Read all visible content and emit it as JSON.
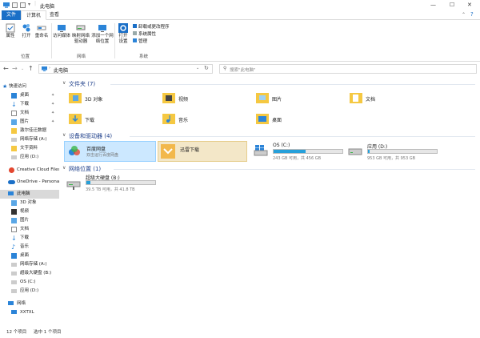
{
  "window": {
    "title": "此电脑"
  },
  "ribbon_tabs": [
    {
      "label": "文件"
    },
    {
      "label": "计算机"
    },
    {
      "label": "查看"
    }
  ],
  "ribbon": {
    "location_buttons": [
      "属性",
      "打开",
      "重命名"
    ],
    "network_buttons": [
      "访问媒体",
      "映射网络驱动器",
      "添加一个网络位置"
    ],
    "open_settings": "打开设置",
    "system_items": [
      "卸载或更改程序",
      "系统属性",
      "管理"
    ],
    "groups": {
      "location": "位置",
      "network": "网络",
      "system": "系统"
    }
  },
  "address": {
    "path": "此电脑",
    "search_placeholder": "搜索\"此电脑\""
  },
  "sidebar": {
    "quick_access": "快速访问",
    "quick_items": [
      "桌面",
      "下载",
      "文档",
      "图片",
      "激尔佳迁数据",
      "网络存储 (A:)",
      "文字资料",
      "应用 (D:)"
    ],
    "creative_cloud": "Creative Cloud Files",
    "onedrive": "OneDrive - Personal",
    "this_pc": "此电脑",
    "pc_items": [
      "3D 对象",
      "视频",
      "图片",
      "文档",
      "下载",
      "音乐",
      "桌面",
      "网络存储 (A:)",
      "超级大硬盘 (B:)",
      "OS (C:)",
      "应用 (D:)"
    ],
    "network": "网络",
    "network_items": [
      "XXTXL"
    ]
  },
  "main": {
    "folders_header": "文件夹 (7)",
    "folders": [
      "3D 对象",
      "视频",
      "图片",
      "文档",
      "下载",
      "音乐",
      "桌面"
    ],
    "devices_header": "设备和驱动器 (4)",
    "apps": [
      {
        "name": "百度网盘",
        "sub": "双击运行百度网盘"
      },
      {
        "name": "迅雷下载",
        "sub": ""
      }
    ],
    "drives": [
      {
        "name": "OS (C:)",
        "free": "243 GB 可用，共 456 GB",
        "used_fraction": 0.47
      },
      {
        "name": "应用 (D:)",
        "free": "953 GB 可用，共 953 GB",
        "used_fraction": 0.02
      }
    ],
    "network_header": "网络位置 (1)",
    "network_locations": [
      {
        "name": "超级大硬盘 (B:)",
        "free": "39.5 TB 可用，共 41.8 TB",
        "used_fraction": 0.06
      }
    ]
  },
  "status": {
    "items": "12 个项目",
    "selected": "选中 1 个项目"
  },
  "colors": {
    "accent": "#1a6fc7",
    "bar": "#26a0da",
    "folder": "#f5c842",
    "selected": "#cce8ff"
  }
}
